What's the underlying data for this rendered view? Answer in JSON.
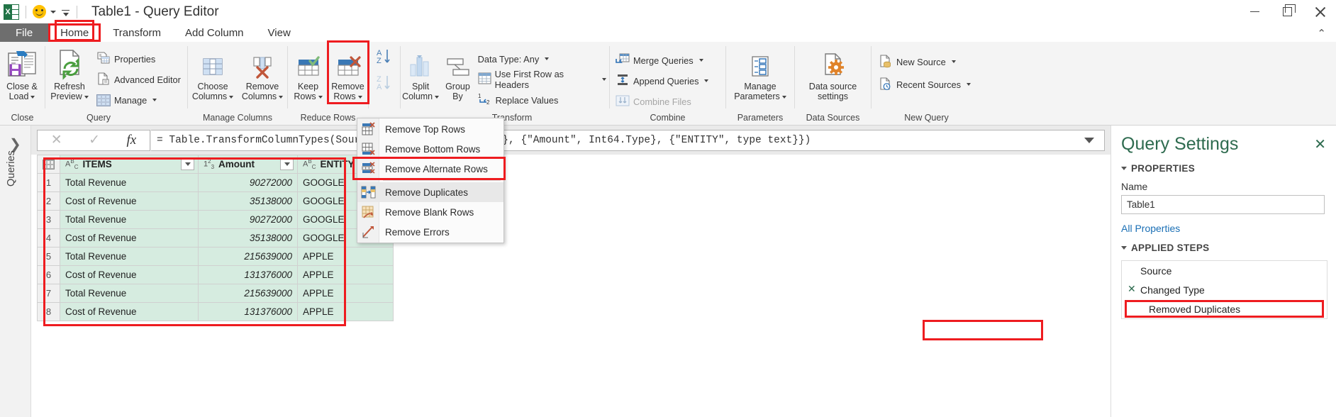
{
  "titlebar": {
    "app_icon": "excel-icon",
    "qat_smiley": "smiley-icon",
    "title": "Table1 - Query Editor",
    "minimize": "minimize-icon",
    "maximize": "maximize-icon",
    "close": "close-icon"
  },
  "tabs": [
    {
      "label": "File",
      "active": false
    },
    {
      "label": "Home",
      "active": true
    },
    {
      "label": "Transform",
      "active": false
    },
    {
      "label": "Add Column",
      "active": false
    },
    {
      "label": "View",
      "active": false
    }
  ],
  "ribbon": {
    "groups": [
      {
        "name": "Close",
        "label": "Close",
        "items": [
          {
            "label": "Close &\nLoad",
            "has_dropdown": true
          }
        ]
      },
      {
        "name": "Query",
        "label": "Query",
        "items": [
          {
            "label": "Refresh\nPreview",
            "has_dropdown": true
          },
          {
            "label": "Properties",
            "has_dropdown": false
          },
          {
            "label": "Advanced Editor",
            "has_dropdown": false
          },
          {
            "label": "Manage",
            "has_dropdown": true
          }
        ]
      },
      {
        "name": "Manage Columns",
        "label": "Manage Columns",
        "items": [
          {
            "label": "Choose\nColumns",
            "has_dropdown": true
          },
          {
            "label": "Remove\nColumns",
            "has_dropdown": true
          }
        ]
      },
      {
        "name": "Reduce Rows",
        "label": "Reduce Rows",
        "items": [
          {
            "label": "Keep\nRows",
            "has_dropdown": true
          },
          {
            "label": "Remove\nRows",
            "has_dropdown": true,
            "highlighted": true
          }
        ]
      },
      {
        "name": "Sort",
        "label": "",
        "items": [
          {
            "label": "sort-ascending",
            "has_dropdown": false
          },
          {
            "label": "sort-descending",
            "has_dropdown": false
          }
        ]
      },
      {
        "name": "Transform",
        "label": "Transform",
        "items": [
          {
            "label": "Split\nColumn",
            "has_dropdown": true
          },
          {
            "label": "Group\nBy",
            "has_dropdown": false
          },
          {
            "label": "Data Type: Any",
            "has_dropdown": true
          },
          {
            "label": "Use First Row as Headers",
            "has_dropdown": true
          },
          {
            "label": "Replace Values",
            "has_dropdown": false
          }
        ]
      },
      {
        "name": "Combine",
        "label": "Combine",
        "items": [
          {
            "label": "Merge Queries",
            "has_dropdown": true
          },
          {
            "label": "Append Queries",
            "has_dropdown": true
          },
          {
            "label": "Combine Files",
            "has_dropdown": false,
            "disabled": true
          }
        ]
      },
      {
        "name": "Parameters",
        "label": "Parameters",
        "items": [
          {
            "label": "Manage\nParameters",
            "has_dropdown": true
          }
        ]
      },
      {
        "name": "Data Sources",
        "label": "Data Sources",
        "items": [
          {
            "label": "Data source\nsettings",
            "has_dropdown": false
          }
        ]
      },
      {
        "name": "New Query",
        "label": "New Query",
        "items": [
          {
            "label": "New Source",
            "has_dropdown": true
          },
          {
            "label": "Recent Sources",
            "has_dropdown": true
          }
        ]
      }
    ],
    "labels": {
      "close_and_load": "Close &",
      "close_and_load2": "Load",
      "refresh": "Refresh",
      "refresh2": "Preview",
      "properties": "Properties",
      "advanced_editor": "Advanced Editor",
      "manage": "Manage",
      "choose_columns": "Choose",
      "choose_columns2": "Columns",
      "remove_columns": "Remove",
      "remove_columns2": "Columns",
      "keep_rows": "Keep",
      "keep_rows2": "Rows",
      "remove_rows": "Remove",
      "remove_rows2": "Rows",
      "split_column": "Split",
      "split_column2": "Column",
      "group_by": "Group",
      "group_by2": "By",
      "data_type": "Data Type: Any",
      "use_first_row": "Use First Row as Headers",
      "replace_values": "Replace Values",
      "merge_queries": "Merge Queries",
      "append_queries": "Append Queries",
      "combine_files": "Combine Files",
      "manage_parameters": "Manage",
      "manage_parameters2": "Parameters",
      "data_source": "Data source",
      "data_source2": "settings",
      "new_source": "New Source",
      "recent_sources": "Recent Sources",
      "g_close": "Close",
      "g_query": "Query",
      "g_manage_columns": "Manage Columns",
      "g_reduce_rows": "Reduce Rows",
      "g_transform": "Transform",
      "g_combine": "Combine",
      "g_parameters": "Parameters",
      "g_data_sources": "Data Sources",
      "g_new_query": "New Query"
    }
  },
  "dropdown_menu": {
    "name": "remove-rows-menu",
    "items": [
      {
        "label": "Remove Top Rows",
        "icon": "remove-top-rows-icon",
        "selected": false
      },
      {
        "label": "Remove Bottom Rows",
        "icon": "remove-bottom-rows-icon",
        "selected": false
      },
      {
        "label": "Remove Alternate Rows",
        "icon": "remove-alternate-rows-icon",
        "selected": false
      },
      {
        "label": "Remove Duplicates",
        "icon": "remove-duplicates-icon",
        "selected": true
      },
      {
        "label": "Remove Blank Rows",
        "icon": "remove-blank-rows-icon",
        "selected": false
      },
      {
        "label": "Remove Errors",
        "icon": "remove-errors-icon",
        "selected": false
      }
    ]
  },
  "queries_pane": {
    "expand_icon": "chevron-right-icon",
    "label": "Queries"
  },
  "formula_bar": {
    "cancel_icon": "cancel-x-icon",
    "confirm_icon": "confirm-check-icon",
    "fx_icon": "fx-icon",
    "formula": "= Table.TransformColumnTypes(Source,{{\"ITEMS\", type text}, {\"Amount\", Int64.Type}, {\"ENTITY\", type text}})",
    "expand_icon2": "expand-formula-icon"
  },
  "table": {
    "corner_icon": "select-all-icon",
    "columns": [
      {
        "name": "ITEMS",
        "type_icon": "ABC",
        "align": "left"
      },
      {
        "name": "Amount",
        "type_icon": "123",
        "align": "right"
      },
      {
        "name": "ENTITY",
        "type_icon": "ABC",
        "align": "left"
      }
    ],
    "rows": [
      {
        "n": "1",
        "ITEMS": "Total Revenue",
        "Amount": "90272000",
        "ENTITY": "GOOGLE"
      },
      {
        "n": "2",
        "ITEMS": "Cost of Revenue",
        "Amount": "35138000",
        "ENTITY": "GOOGLE"
      },
      {
        "n": "3",
        "ITEMS": "Total Revenue",
        "Amount": "90272000",
        "ENTITY": "GOOGLE"
      },
      {
        "n": "4",
        "ITEMS": "Cost of Revenue",
        "Amount": "35138000",
        "ENTITY": "GOOGLE"
      },
      {
        "n": "5",
        "ITEMS": "Total Revenue",
        "Amount": "215639000",
        "ENTITY": "APPLE"
      },
      {
        "n": "6",
        "ITEMS": "Cost of Revenue",
        "Amount": "131376000",
        "ENTITY": "APPLE"
      },
      {
        "n": "7",
        "ITEMS": "Total Revenue",
        "Amount": "215639000",
        "ENTITY": "APPLE"
      },
      {
        "n": "8",
        "ITEMS": "Cost of Revenue",
        "Amount": "131376000",
        "ENTITY": "APPLE"
      }
    ]
  },
  "query_settings": {
    "title": "Query Settings",
    "close_icon": "close-panel-icon",
    "properties_section": "PROPERTIES",
    "name_label": "Name",
    "name_value": "Table1",
    "all_properties_link": "All Properties",
    "applied_steps_section": "APPLIED STEPS",
    "steps": [
      {
        "label": "Source",
        "has_gear": false,
        "highlighted": false
      },
      {
        "label": "Changed Type",
        "has_gear": true,
        "highlighted": false
      },
      {
        "label": "Removed Duplicates",
        "has_gear": false,
        "highlighted": true
      }
    ]
  },
  "colors": {
    "accent_green": "#2e6b4f",
    "table_fill": "#d6ece0",
    "annotation_red": "#ee1c20",
    "file_tab": "#6e6e6e",
    "ribbon_bg": "#f4f4f4"
  }
}
